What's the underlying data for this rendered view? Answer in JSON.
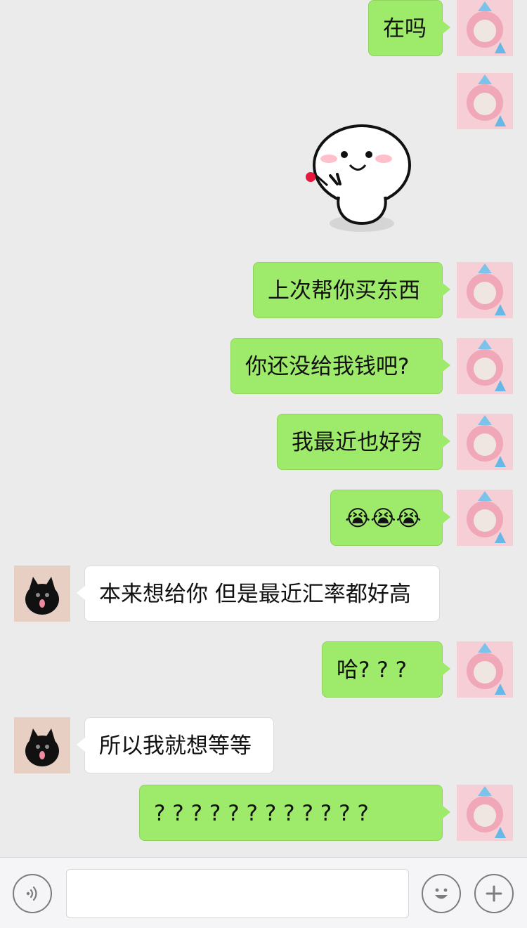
{
  "messages": [
    {
      "side": "right",
      "text": "在吗"
    },
    {
      "side": "right",
      "type": "sticker",
      "sticker": "smiling-peace-sign-blob-sticker"
    },
    {
      "side": "right",
      "text": "上次帮你买东西"
    },
    {
      "side": "right",
      "text": "你还没给我钱吧?"
    },
    {
      "side": "right",
      "text": "我最近也好穷"
    },
    {
      "side": "right",
      "text": "😭😭😭"
    },
    {
      "side": "left",
      "text": "本来想给你 但是最近汇率都好高"
    },
    {
      "side": "right",
      "text": "哈? ? ?"
    },
    {
      "side": "left",
      "text": "所以我就想等等"
    },
    {
      "side": "right",
      "text": "? ? ? ? ? ? ? ? ? ? ? ?"
    }
  ],
  "composer": {
    "input_value": "",
    "voice_icon": "voice-icon",
    "emoji_icon": "emoji-icon",
    "plus_icon": "plus-icon"
  },
  "colors": {
    "chat_background": "#ebebeb",
    "my_bubble": "#9eea6a",
    "other_bubble": "#ffffff",
    "footer": "#f5f5f7"
  }
}
